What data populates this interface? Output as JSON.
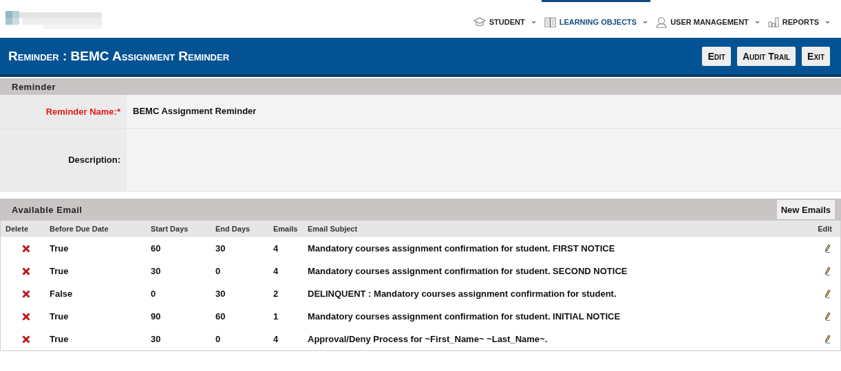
{
  "nav": [
    {
      "label": "STUDENT",
      "selected": false
    },
    {
      "label": "LEARNING OBJECTS",
      "selected": true
    },
    {
      "label": "USER MANAGEMENT",
      "selected": false
    },
    {
      "label": "REPORTS",
      "selected": false
    }
  ],
  "header": {
    "title": "Reminder : BEMC Assignment Reminder",
    "buttons": [
      "Edit",
      "Audit Trail",
      "Exit"
    ]
  },
  "reminder": {
    "title": "Reminder",
    "fields": [
      {
        "label": "Reminder Name:*",
        "required": true,
        "value": "BEMC Assignment Reminder",
        "kind": "line"
      },
      {
        "label": "Description:",
        "required": false,
        "kind": "area"
      }
    ]
  },
  "emails": {
    "title": "Available Email",
    "new_button": "New Emails",
    "columns": [
      "Delete",
      "Before Due Date",
      "Start Days",
      "End Days",
      "Emails",
      "Email Subject",
      "Edit"
    ],
    "rows": [
      {
        "before_due_date": "True",
        "start_days": "60",
        "end_days": "30",
        "emails": "4",
        "subject": "Mandatory courses assignment confirmation for student. FIRST NOTICE"
      },
      {
        "before_due_date": "True",
        "start_days": "30",
        "end_days": "0",
        "emails": "4",
        "subject": "Mandatory courses assignment confirmation for student. SECOND NOTICE"
      },
      {
        "before_due_date": "False",
        "start_days": "0",
        "end_days": "30",
        "emails": "2",
        "subject": "DELINQUENT : Mandatory courses assignment confirmation for student."
      },
      {
        "before_due_date": "True",
        "start_days": "90",
        "end_days": "60",
        "emails": "1",
        "subject": "Mandatory courses assignment confirmation for student. INITIAL NOTICE"
      },
      {
        "before_due_date": "True",
        "start_days": "30",
        "end_days": "0",
        "emails": "4",
        "subject": "Approval/Deny Process for ~First_Name~ ~Last_Name~."
      }
    ]
  }
}
